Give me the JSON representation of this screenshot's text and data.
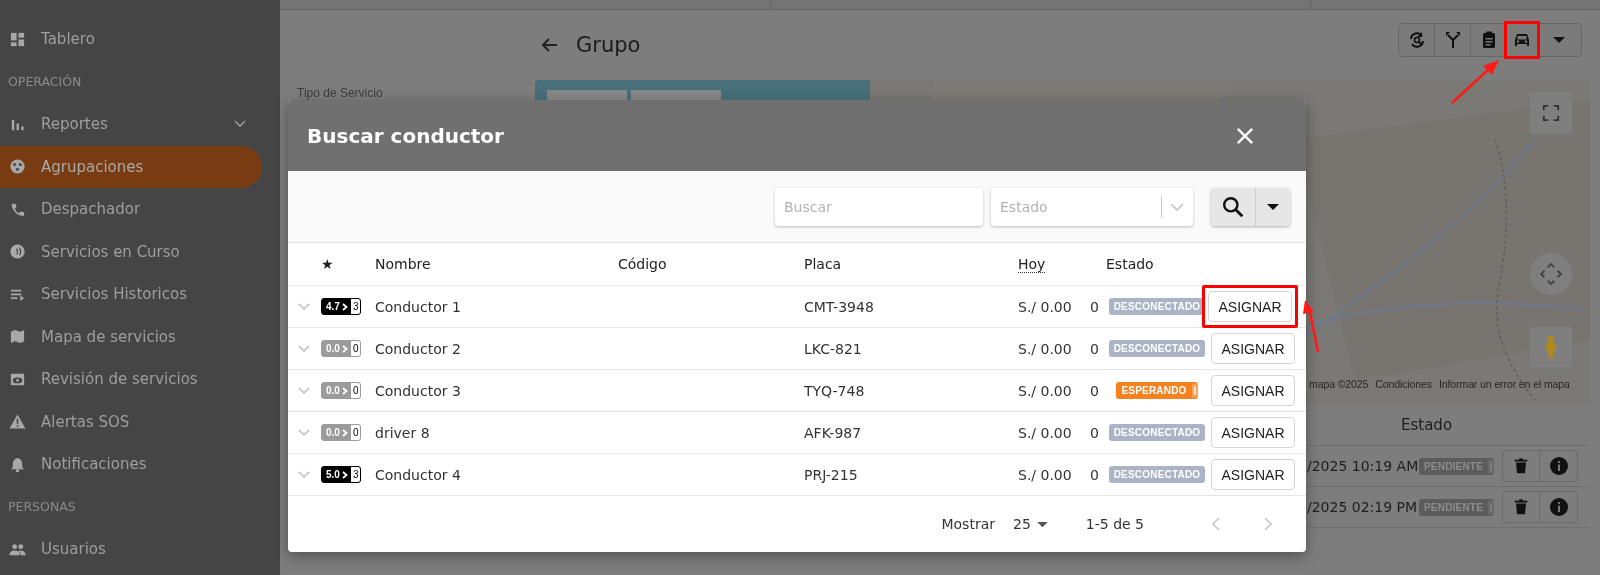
{
  "sidebar": {
    "items": [
      {
        "kind": "item",
        "label": "Tablero",
        "selected": false
      },
      {
        "kind": "section",
        "label": "OPERACIÓN"
      },
      {
        "kind": "item",
        "label": "Reportes",
        "selected": false,
        "expanded": false
      },
      {
        "kind": "item",
        "label": "Agrupaciones",
        "selected": true
      },
      {
        "kind": "item",
        "label": "Despachador",
        "selected": false
      },
      {
        "kind": "item",
        "label": "Servicios en Curso",
        "selected": false
      },
      {
        "kind": "item",
        "label": "Servicios Historicos",
        "selected": false
      },
      {
        "kind": "item",
        "label": "Mapa de servicios",
        "selected": false
      },
      {
        "kind": "item",
        "label": "Revisión de servicios",
        "selected": false
      },
      {
        "kind": "item",
        "label": "Alertas SOS",
        "selected": false
      },
      {
        "kind": "item",
        "label": "Notificaciones",
        "selected": false
      },
      {
        "kind": "section",
        "label": "PERSONAS"
      },
      {
        "kind": "item",
        "label": "Usuarios",
        "selected": false
      }
    ]
  },
  "page": {
    "title": "Grupo",
    "filter_label": "Tipo de Servicio",
    "toolbar": [
      {
        "kind": "refresh",
        "highlighted": false
      },
      {
        "kind": "fork",
        "highlighted": false
      },
      {
        "kind": "clipboard",
        "highlighted": false
      },
      {
        "kind": "car",
        "highlighted": true
      },
      {
        "kind": "caret",
        "highlighted": false
      }
    ]
  },
  "map": {
    "kind": "picture",
    "attribution": [
      "mapa ©2025",
      "Condiciones",
      "Informar un error en el mapa"
    ]
  },
  "services_table": {
    "columns": [
      "Estado"
    ],
    "rows": [
      {
        "date": "/2025 10:19 AM",
        "status": {
          "kind": "pending",
          "label": "PENDIENTE"
        }
      },
      {
        "date": "/2025 02:19 PM",
        "status": {
          "kind": "pending",
          "label": "PENDIENTE"
        }
      }
    ]
  },
  "modal": {
    "title": "Buscar conductor",
    "search": {
      "placeholder": "Buscar"
    },
    "status_filter": {
      "placeholder": "Estado"
    },
    "columns": [
      "★",
      "Nombre",
      "Código",
      "Placa",
      "Hoy",
      "Estado"
    ],
    "rows": [
      {
        "rating": "4.7",
        "rating_count": "3",
        "rated": true,
        "name": "Conductor 1",
        "plate": "CMT-3948",
        "today": "S./ 0.00",
        "trips": "0",
        "status": {
          "kind": "disconnected",
          "label": "DESCONECTADO"
        },
        "action": "ASIGNAR",
        "highlighted": true
      },
      {
        "rating": "0.0",
        "rating_count": "0",
        "rated": false,
        "name": "Conductor 2",
        "plate": "LKC-821",
        "today": "S./ 0.00",
        "trips": "0",
        "status": {
          "kind": "disconnected",
          "label": "DESCONECTADO"
        },
        "action": "ASIGNAR",
        "highlighted": false
      },
      {
        "rating": "0.0",
        "rating_count": "0",
        "rated": false,
        "name": "Conductor 3",
        "plate": "TYQ-748",
        "today": "S./ 0.00",
        "trips": "0",
        "status": {
          "kind": "waiting",
          "label": "ESPERANDO"
        },
        "action": "ASIGNAR",
        "highlighted": false
      },
      {
        "rating": "0.0",
        "rating_count": "0",
        "rated": false,
        "name": "driver 8",
        "plate": "AFK-987",
        "today": "S./ 0.00",
        "trips": "0",
        "status": {
          "kind": "disconnected",
          "label": "DESCONECTADO"
        },
        "action": "ASIGNAR",
        "highlighted": false
      },
      {
        "rating": "5.0",
        "rating_count": "3",
        "rated": true,
        "name": "Conductor 4",
        "plate": "PRJ-215",
        "today": "S./ 0.00",
        "trips": "0",
        "status": {
          "kind": "disconnected",
          "label": "DESCONECTADO"
        },
        "action": "ASIGNAR",
        "highlighted": false
      }
    ],
    "footer": {
      "show_label": "Mostrar",
      "page_size": "25",
      "range": "1-5 de 5"
    }
  }
}
